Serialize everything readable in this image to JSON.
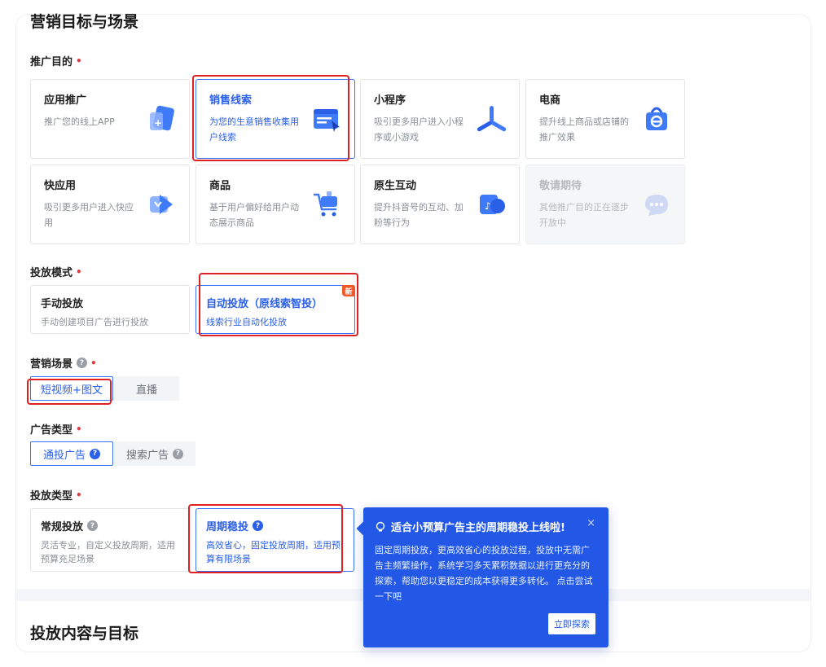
{
  "section1": {
    "title": "营销目标与场景",
    "purpose_label": "推广目的",
    "tiles": [
      {
        "title": "应用推广",
        "desc": "推广您的线上APP",
        "icon": "app-promo-icon",
        "state": "normal"
      },
      {
        "title": "销售线索",
        "desc": "为您的生意销售收集用户线索",
        "icon": "sales-leads-icon",
        "state": "selected"
      },
      {
        "title": "小程序",
        "desc": "吸引更多用户进入小程序或小游戏",
        "icon": "mini-program-icon",
        "state": "normal"
      },
      {
        "title": "电商",
        "desc": "提升线上商品或店铺的推广效果",
        "icon": "ecommerce-icon",
        "state": "normal"
      },
      {
        "title": "快应用",
        "desc": "吸引更多用户进入快应用",
        "icon": "quick-app-icon",
        "state": "normal"
      },
      {
        "title": "商品",
        "desc": "基于用户偏好给用户动态展示商品",
        "icon": "product-icon",
        "state": "normal"
      },
      {
        "title": "原生互动",
        "desc": "提升抖音号的互动、加粉等行为",
        "icon": "native-interaction-icon",
        "state": "normal"
      },
      {
        "title": "敬请期待",
        "desc": "其他推广目的正在逐步开放中",
        "icon": "coming-soon-icon",
        "state": "disabled"
      }
    ],
    "mode_label": "投放模式",
    "modes": [
      {
        "title": "手动投放",
        "desc": "手动创建项目广告进行投放",
        "state": "normal"
      },
      {
        "title": "自动投放（原线索智投）",
        "desc": "线索行业自动化投放",
        "state": "selected",
        "badge": "新"
      }
    ],
    "scene_label": "营销场景",
    "scenes": [
      {
        "label": "短视频+图文",
        "state": "on"
      },
      {
        "label": "直播",
        "state": "off"
      }
    ],
    "adtype_label": "广告类型",
    "adtypes": [
      {
        "label": "通投广告",
        "state": "on"
      },
      {
        "label": "搜索广告",
        "state": "off"
      }
    ],
    "delivery_label": "投放类型",
    "deliveries": [
      {
        "title": "常规投放",
        "desc": "灵活专业，自定义投放周期，适用预算充足场景",
        "state": "normal"
      },
      {
        "title": "周期稳投",
        "desc": "高效省心，固定投放周期，适用预算有限场景",
        "state": "selected"
      }
    ]
  },
  "section2": {
    "title": "投放内容与目标"
  },
  "popup": {
    "title": "适合小预算广告主的周期稳投上线啦!",
    "body": "固定周期投放，更高效省心的投放过程，投放中无需广告主频繁操作，系统学习多天累积数据以进行更充分的探索，帮助您以更稳定的成本获得更多转化。 点击尝试一下吧",
    "button": "立即探索",
    "close": "×"
  },
  "colors": {
    "accent": "#2a5fe8",
    "highlight": "#e02020",
    "popup_bg": "#2358e6"
  }
}
